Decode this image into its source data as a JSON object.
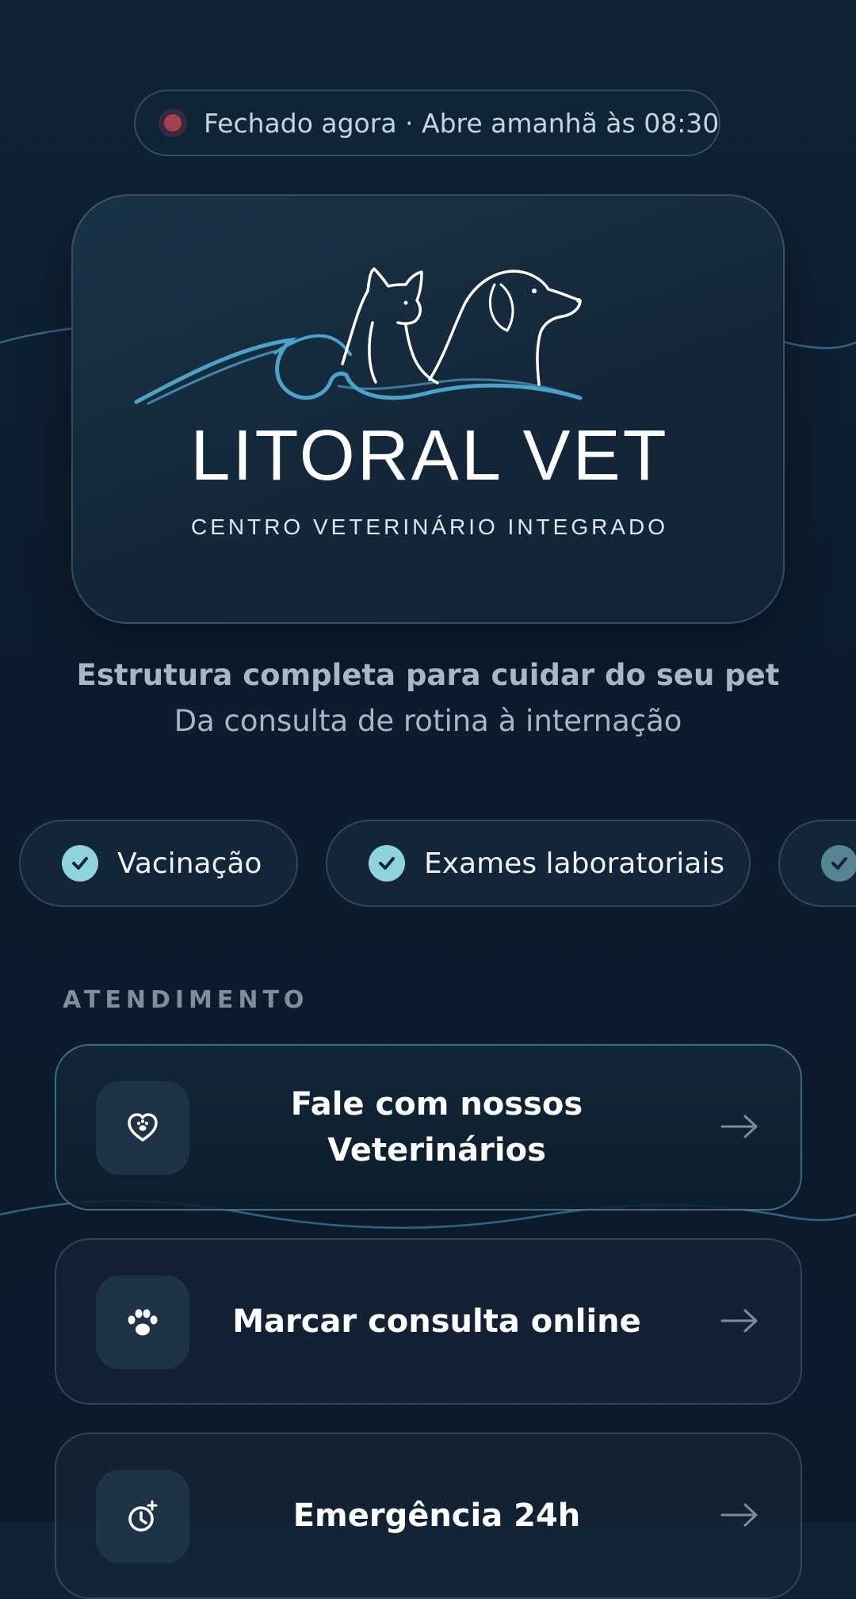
{
  "status": {
    "text": "Fechado agora · Abre amanhã às 08:30",
    "indicator_color": "#a3414c"
  },
  "logo": {
    "name": "LITORAL VET",
    "tagline": "CENTRO VETERINÁRIO INTEGRADO",
    "accent_color": "#4aa3c9"
  },
  "hero": {
    "headline": "Estrutura completa para cuidar do seu pet",
    "subheadline": "Da consulta de rotina à internação"
  },
  "chips": [
    {
      "label": "Vacinação",
      "icon": "check-icon"
    },
    {
      "label": "Exames laboratoriais",
      "icon": "check-icon"
    },
    {
      "label": "",
      "icon": "check-icon"
    }
  ],
  "section": {
    "title": "ATENDIMENTO"
  },
  "actions": [
    {
      "label": "Fale com nossos Veterinários",
      "icon": "heart-paw-icon"
    },
    {
      "label": "Marcar consulta online",
      "icon": "paw-icon"
    },
    {
      "label": "Emergência 24h",
      "icon": "timer-icon"
    }
  ],
  "colors": {
    "background": "#0c1c2e",
    "chip_check": "#8fd3dc",
    "muted_text": "#a9b6c4"
  }
}
